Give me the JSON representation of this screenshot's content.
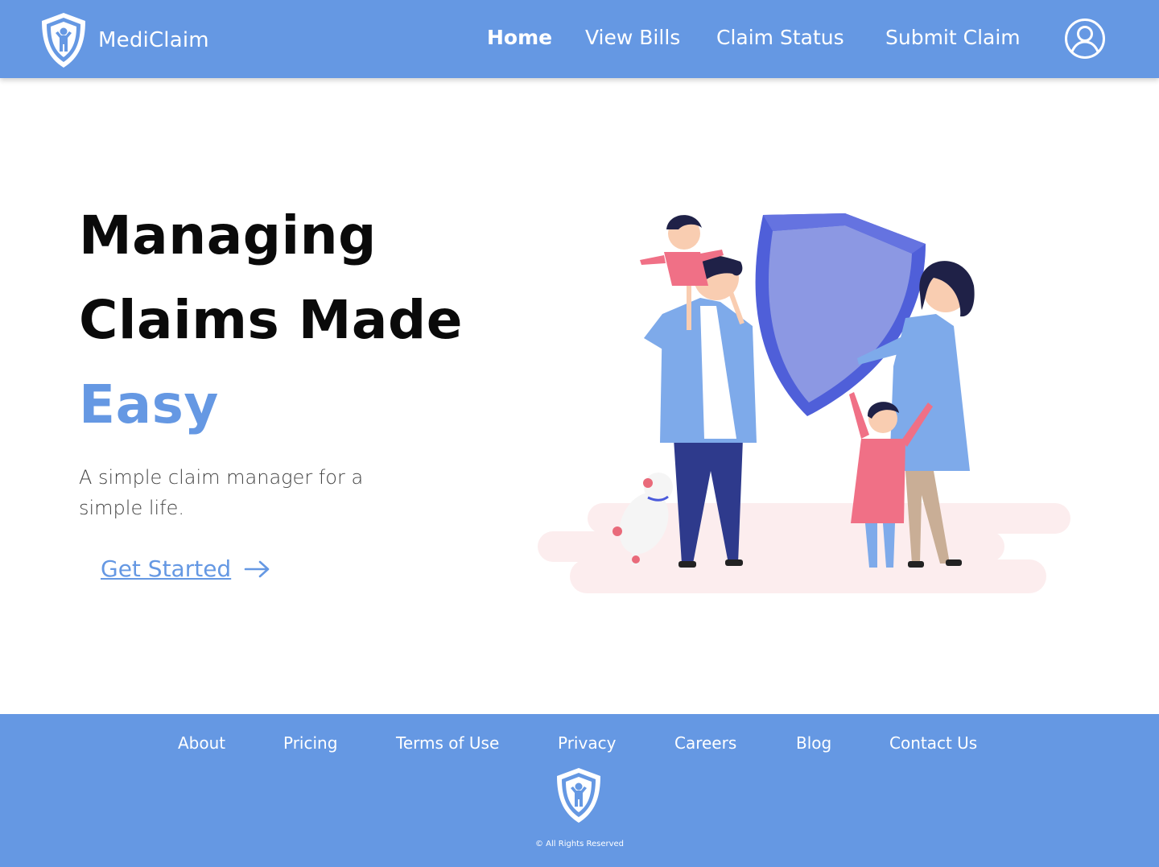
{
  "brand": {
    "name": "MediClaim",
    "logo_icon": "shield-family-icon"
  },
  "nav": {
    "items": [
      {
        "label": "Home",
        "active": true
      },
      {
        "label": "View Bills",
        "active": false
      },
      {
        "label": "Claim Status",
        "active": false
      },
      {
        "label": "Submit Claim",
        "active": false
      }
    ],
    "profile_icon": "user-circle-icon"
  },
  "hero": {
    "title_line1": "Managing",
    "title_line2": "Claims Made",
    "title_accent": "Easy",
    "subtitle": "A simple claim manager for a simple life.",
    "cta_label": "Get Started",
    "cta_icon": "arrow-right-icon",
    "illustration": "family-with-shield-illustration"
  },
  "footer": {
    "links": [
      "About",
      "Pricing",
      "Terms of Use",
      "Privacy",
      "Careers",
      "Blog",
      "Contact Us"
    ],
    "logo_icon": "shield-family-icon",
    "copyright": "© All Rights Reserved"
  },
  "colors": {
    "primary": "#6598E3",
    "text_dark": "#0a0a0a",
    "text_muted": "#444444",
    "white": "#ffffff"
  }
}
